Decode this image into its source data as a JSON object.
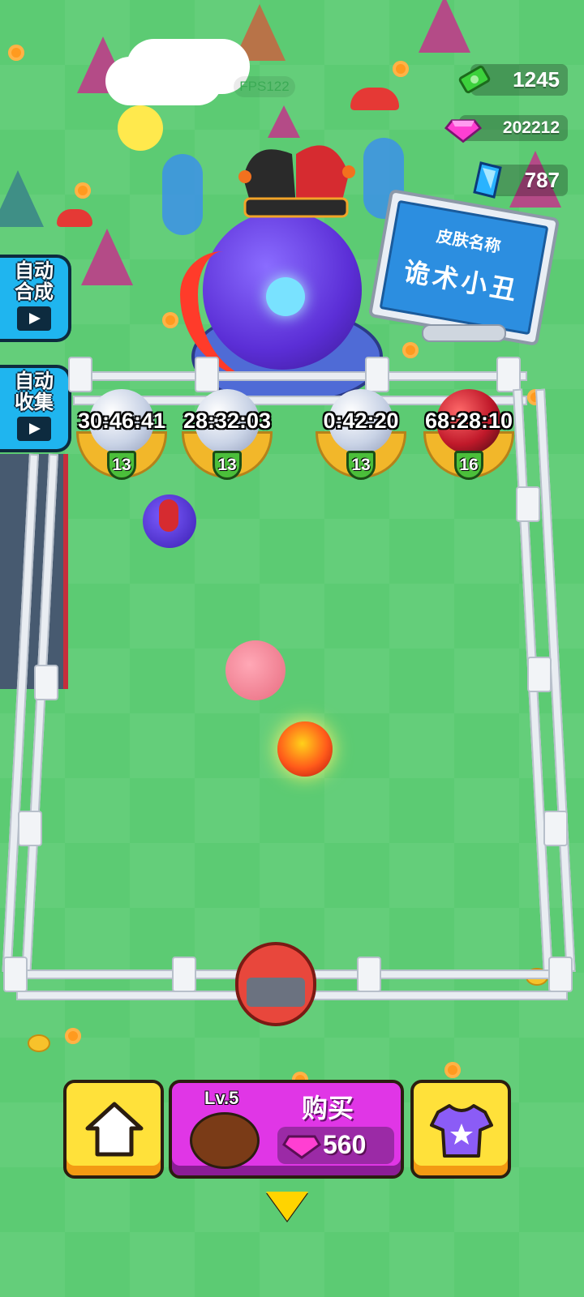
{
  "hud": {
    "fps": "FPS122",
    "currencies": {
      "cash": "1245",
      "pink_gems": "202212",
      "blue_diamonds": "787"
    }
  },
  "side_buttons": {
    "auto_merge": "自动合成",
    "auto_collect": "自动收集"
  },
  "skin_sign": {
    "title": "皮肤名称",
    "name": "诡术小丑"
  },
  "nests": [
    {
      "timer": "30:46:41",
      "level": "13"
    },
    {
      "timer": "28:32:03",
      "level": "13"
    },
    {
      "timer": "0:42:20",
      "level": "13"
    },
    {
      "timer": "68:28:10",
      "level": "16"
    }
  ],
  "bottom_bar": {
    "buy_level": "Lv.5",
    "buy_label": "购买",
    "buy_price": "560"
  },
  "colors": {
    "grass": "#5ccb73",
    "side_button": "#1fb5ef",
    "home_button": "#ffe13a",
    "buy_button": "#e036e6",
    "sign_screen": "#2c8ee0"
  },
  "icons": [
    "cash-icon",
    "pink-gem-icon",
    "blue-diamond-icon",
    "video-icon",
    "home-icon",
    "shirt-icon",
    "chevron-down-icon"
  ]
}
